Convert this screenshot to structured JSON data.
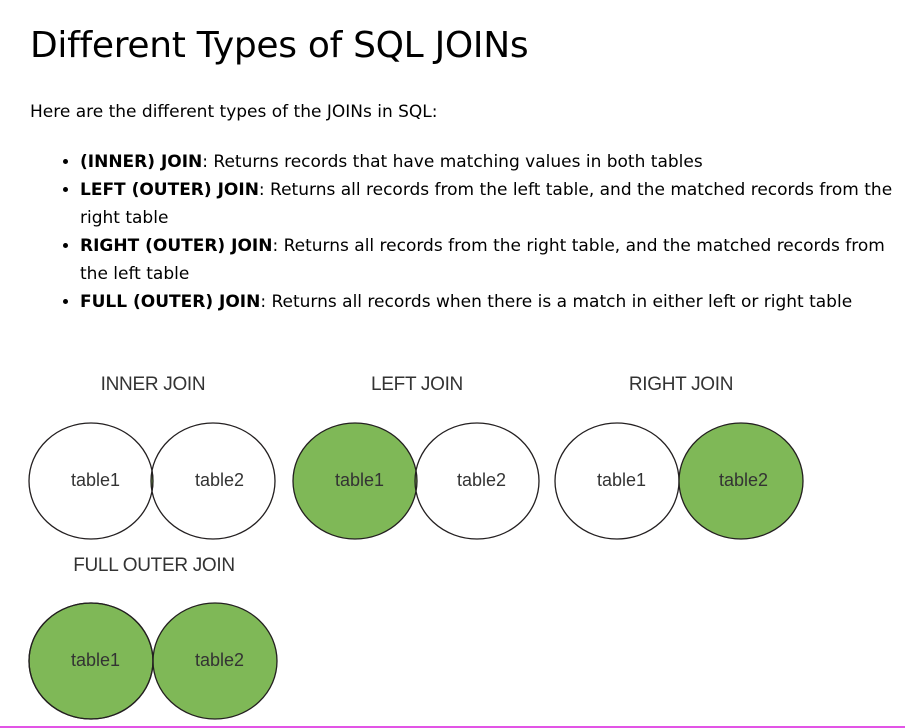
{
  "page": {
    "title": "Different Types of SQL JOINs",
    "intro": "Here are the different types of the JOINs in SQL:"
  },
  "joins": [
    {
      "name": "(INNER) JOIN",
      "description": ": Returns records that have matching values in both tables"
    },
    {
      "name": "LEFT (OUTER) JOIN",
      "description": ": Returns all records from the left table, and the matched records from the right table"
    },
    {
      "name": "RIGHT (OUTER) JOIN",
      "description": ": Returns all records from the right table, and the matched records from the left table"
    },
    {
      "name": "FULL (OUTER) JOIN",
      "description": ": Returns all records when there is a match in either left or right table"
    }
  ],
  "diagrams": [
    {
      "title": "INNER JOIN",
      "left_label": "table1",
      "right_label": "table2",
      "fill": "intersection"
    },
    {
      "title": "LEFT JOIN",
      "left_label": "table1",
      "right_label": "table2",
      "fill": "left"
    },
    {
      "title": "RIGHT JOIN",
      "left_label": "table1",
      "right_label": "table2",
      "fill": "right"
    },
    {
      "title": "FULL OUTER JOIN",
      "left_label": "table1",
      "right_label": "table2",
      "fill": "both"
    }
  ],
  "colors": {
    "fill": "#7fb857",
    "outline": "#231f20",
    "accent_rule": "#e254e6"
  }
}
